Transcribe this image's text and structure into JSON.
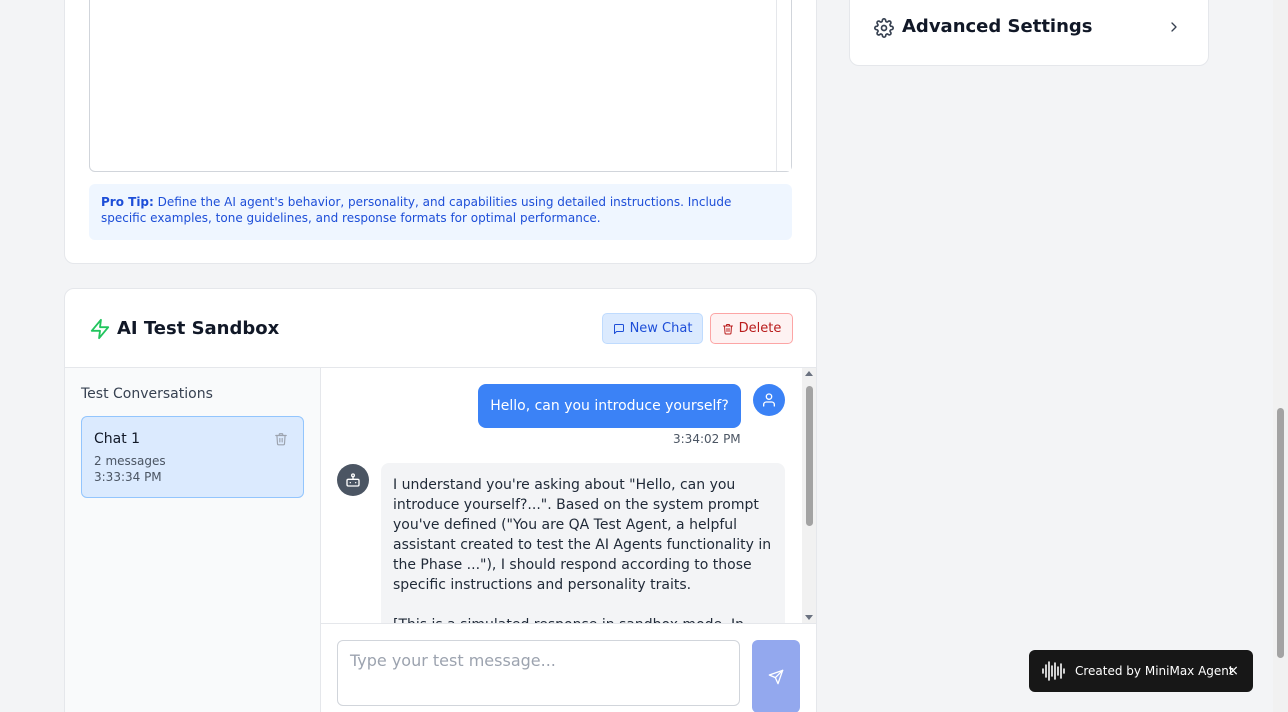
{
  "pro_tip": {
    "label": "Pro Tip:",
    "text": "Define the AI agent's behavior, personality, and capabilities using detailed instructions. Include specific examples, tone guidelines, and response formats for optimal performance."
  },
  "advanced_settings": {
    "title": "Advanced Settings"
  },
  "sandbox": {
    "title": "AI Test Sandbox",
    "new_chat_label": "New Chat",
    "delete_label": "Delete",
    "conversations_heading": "Test Conversations",
    "conversations": [
      {
        "name": "Chat 1",
        "messages": "2 messages",
        "time": "3:33:34 PM"
      }
    ],
    "messages": [
      {
        "role": "user",
        "text": "Hello, can you introduce yourself?",
        "time": "3:34:02 PM"
      },
      {
        "role": "assistant",
        "text": "I understand you're asking about \"Hello, can you introduce yourself?...\". Based on the system prompt you've defined (\"You are QA Test Agent, a helpful assistant created to test the AI Agents functionality in the Phase ...\"), I should respond according to those specific instructions and personality traits.",
        "text2": "[This is a simulated response in sandbox mode. In this"
      }
    ],
    "input_placeholder": "Type your test message..."
  },
  "toast": {
    "text": "Created by MiniMax Agent",
    "close": "×"
  },
  "colors": {
    "accent": "#3b82f6",
    "bolt": "#22c55e",
    "delete": "#b91c1c"
  }
}
